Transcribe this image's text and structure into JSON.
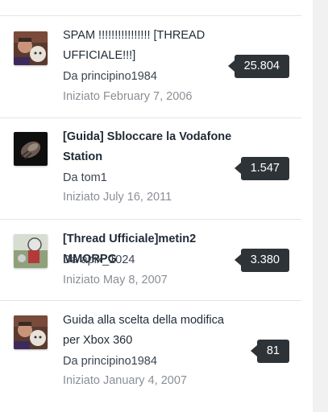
{
  "topics": [
    {
      "title": "SPAM !!!!!!!!!!!!!!!! [THREAD UFFICIALE!!!]",
      "author": "Da principino1984",
      "started": "Iniziato February 7, 2006",
      "replies": "25.804",
      "avatar_icon": "user-avatar-icon"
    },
    {
      "title": "[Guida] Sbloccare la Vodafone Station",
      "author": "Da tom1",
      "started": "Iniziato July 16, 2011",
      "replies": "1.547",
      "avatar_icon": "user-avatar-icon"
    },
    {
      "title": "[Thread Ufficiale]metin2 MMORPG",
      "author": "Da apix_1024",
      "started": "Iniziato May 8, 2007",
      "replies": "3.380",
      "avatar_icon": "user-avatar-icon"
    },
    {
      "title": "Guida alla scelta della modifica per Xbox 360",
      "author": "Da principino1984",
      "started": "Iniziato January 4, 2007",
      "replies": "81",
      "avatar_icon": "user-avatar-icon"
    }
  ],
  "colors": {
    "badge_bg": "#2e3338",
    "title": "#1f2a36",
    "muted": "#8a8f95",
    "divider": "#e5e5e5"
  }
}
